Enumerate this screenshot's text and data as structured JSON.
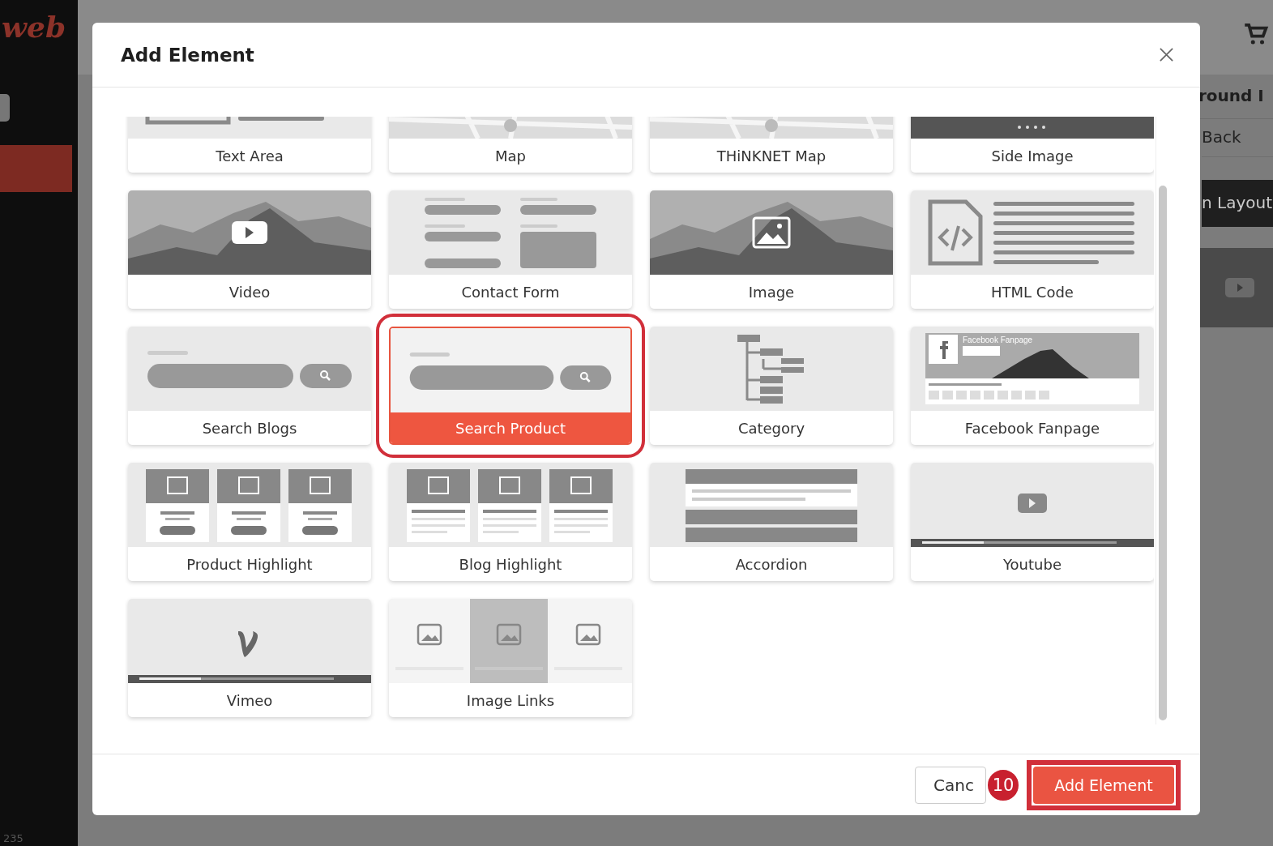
{
  "background": {
    "logo": "web",
    "side_number": "235",
    "heading": "round I",
    "back_link": "Back",
    "layout_button": "n Layout"
  },
  "modal": {
    "title": "Add Element",
    "tiles": [
      {
        "label": "Text Area",
        "kind": "textarea",
        "selected": false
      },
      {
        "label": "Map",
        "kind": "map",
        "selected": false
      },
      {
        "label": "THiNKNET Map",
        "kind": "map",
        "selected": false
      },
      {
        "label": "Side Image",
        "kind": "sideimage",
        "selected": false
      },
      {
        "label": "Video",
        "kind": "video",
        "selected": false
      },
      {
        "label": "Contact Form",
        "kind": "form",
        "selected": false
      },
      {
        "label": "Image",
        "kind": "image",
        "selected": false
      },
      {
        "label": "HTML Code",
        "kind": "html",
        "selected": false
      },
      {
        "label": "Search Blogs",
        "kind": "search",
        "selected": false
      },
      {
        "label": "Search Product",
        "kind": "search",
        "selected": true
      },
      {
        "label": "Category",
        "kind": "category",
        "selected": false
      },
      {
        "label": "Facebook Fanpage",
        "kind": "facebook",
        "selected": false,
        "caption": "Facebook Fanpage"
      },
      {
        "label": "Product Highlight",
        "kind": "product",
        "selected": false
      },
      {
        "label": "Blog Highlight",
        "kind": "blog",
        "selected": false
      },
      {
        "label": "Accordion",
        "kind": "accordion",
        "selected": false
      },
      {
        "label": "Youtube",
        "kind": "youtube",
        "selected": false
      },
      {
        "label": "Vimeo",
        "kind": "vimeo",
        "selected": false
      },
      {
        "label": "Image Links",
        "kind": "imagelinks",
        "selected": false
      }
    ],
    "cancel_button": "Canc",
    "add_button": "Add Element",
    "step_badge": "10"
  }
}
